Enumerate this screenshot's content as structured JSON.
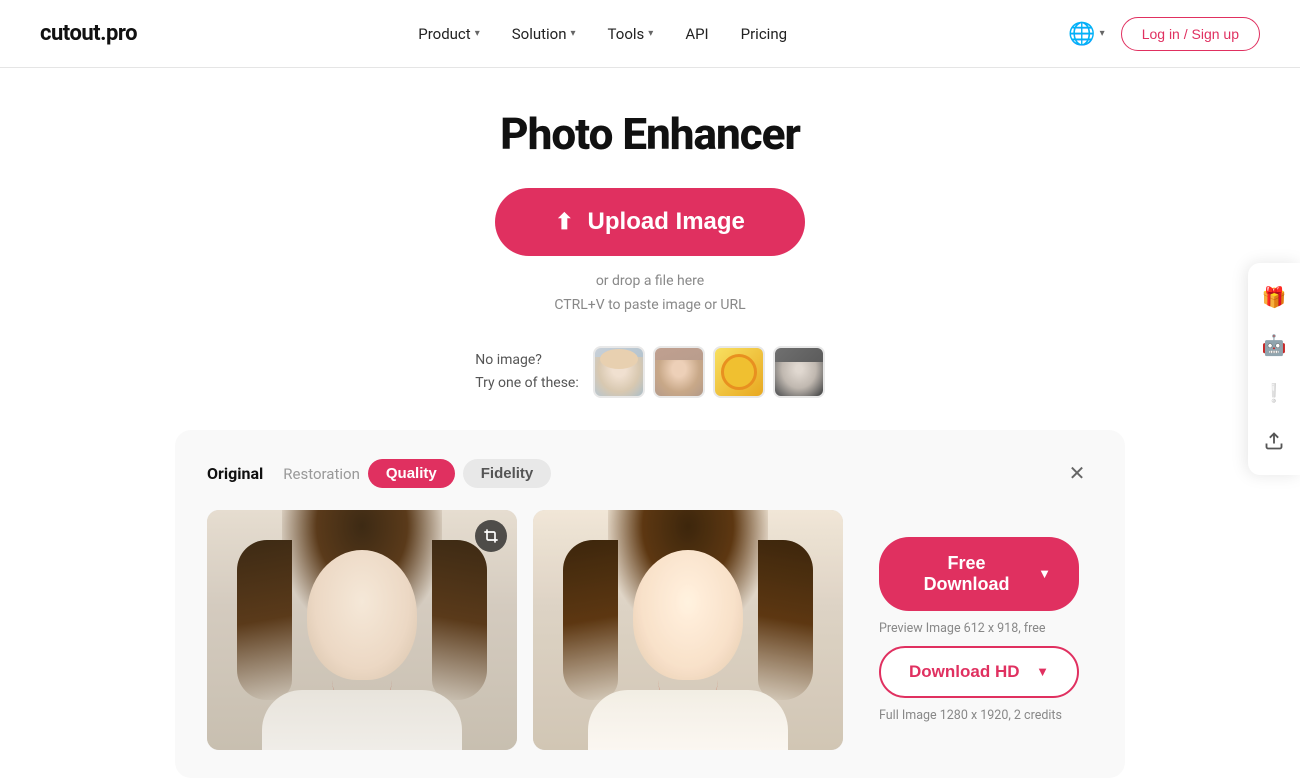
{
  "header": {
    "logo": "cutout.pro",
    "nav": [
      {
        "label": "Product",
        "hasChevron": true
      },
      {
        "label": "Solution",
        "hasChevron": true
      },
      {
        "label": "Tools",
        "hasChevron": true
      },
      {
        "label": "API",
        "hasChevron": false
      },
      {
        "label": "Pricing",
        "hasChevron": false
      }
    ],
    "login_label": "Log in / Sign up"
  },
  "page": {
    "title": "Photo Enhancer",
    "upload_btn": "Upload Image",
    "drop_hint_line1": "or drop a file here",
    "drop_hint_line2": "CTRL+V to paste image or URL",
    "sample_label_line1": "No image?",
    "sample_label_line2": "Try one of these:"
  },
  "preview": {
    "tab_original": "Original",
    "tab_restoration": "Restoration",
    "tab_quality": "Quality",
    "tab_fidelity": "Fidelity",
    "free_download_label": "Free Download",
    "preview_note": "Preview Image 612 x 918, free",
    "download_hd_label": "Download HD",
    "full_image_note": "Full Image 1280 x 1920, 2 credits"
  },
  "sidebar": {
    "icons": [
      {
        "name": "gift-icon",
        "symbol": "🎁"
      },
      {
        "name": "avatar-icon",
        "symbol": "🤖"
      },
      {
        "name": "notification-icon",
        "symbol": "❗"
      },
      {
        "name": "upload-sidebar-icon",
        "symbol": "⬆"
      }
    ]
  }
}
